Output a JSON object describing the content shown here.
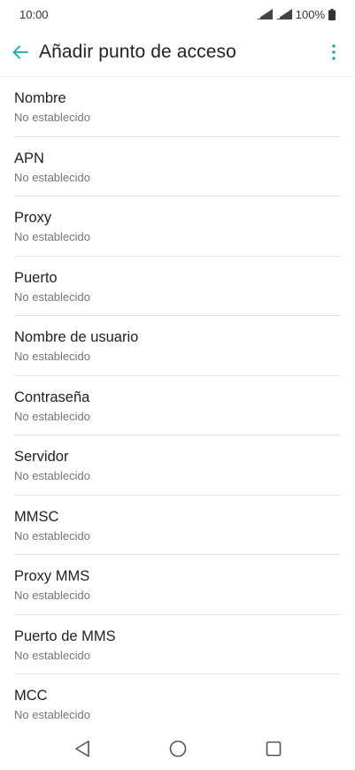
{
  "status_bar": {
    "time": "10:00",
    "battery": "100%"
  },
  "app_bar": {
    "title": "Añadir punto de acceso",
    "accent_color": "#1aa3b8"
  },
  "items": [
    {
      "title": "Nombre",
      "value": "No establecido"
    },
    {
      "title": "APN",
      "value": "No establecido"
    },
    {
      "title": "Proxy",
      "value": "No establecido"
    },
    {
      "title": "Puerto",
      "value": "No establecido"
    },
    {
      "title": "Nombre de usuario",
      "value": "No establecido"
    },
    {
      "title": "Contraseña",
      "value": "No establecido"
    },
    {
      "title": "Servidor",
      "value": "No establecido"
    },
    {
      "title": "MMSC",
      "value": "No establecido"
    },
    {
      "title": "Proxy MMS",
      "value": "No establecido"
    },
    {
      "title": "Puerto de MMS",
      "value": "No establecido"
    },
    {
      "title": "MCC",
      "value": "No establecido"
    }
  ],
  "icons": {
    "back": "arrow-left-icon",
    "more": "more-vert-icon",
    "nav_back": "triangle-back-icon",
    "nav_home": "circle-home-icon",
    "nav_recents": "square-recents-icon"
  }
}
